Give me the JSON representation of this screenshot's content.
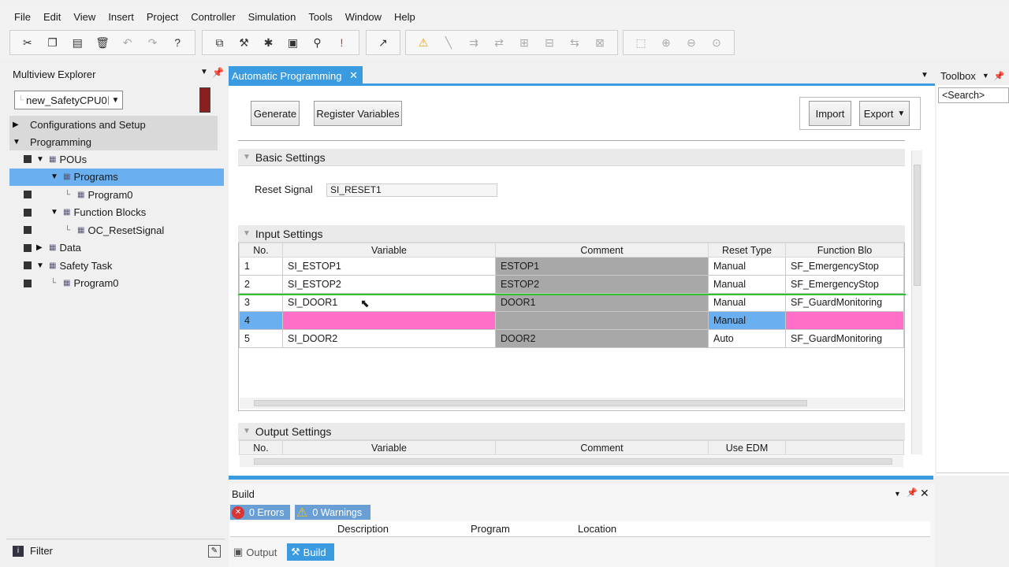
{
  "menu": [
    "File",
    "Edit",
    "View",
    "Insert",
    "Project",
    "Controller",
    "Simulation",
    "Tools",
    "Window",
    "Help"
  ],
  "toolbar_icons": [
    "cut-icon",
    "copy-icon",
    "paste-icon",
    "delete-icon",
    "undo-icon",
    "redo-icon",
    "help-icon",
    "window-icon",
    "build-icon",
    "check-icon",
    "report-icon",
    "find-icon",
    "error-icon",
    "online-icon",
    "warning-icon",
    "pencil-icon",
    "diagram-icon",
    "diagram-icon",
    "diagram-icon",
    "diagram-icon",
    "diagram-icon",
    "diagram-icon",
    "fit-icon",
    "zoom-in-icon",
    "zoom-out-icon",
    "zoom-100-icon"
  ],
  "explorer": {
    "title": "Multiview Explorer",
    "device": "new_SafetyCPU0",
    "config": "Configurations and Setup",
    "programming": "Programming",
    "tree": [
      {
        "label": "POUs",
        "indent": 0,
        "arrow": "▼",
        "icon": "pou-icon"
      },
      {
        "label": "Programs",
        "indent": 1,
        "arrow": "▼",
        "icon": "programs-icon",
        "selected": true
      },
      {
        "label": "Program0",
        "indent": 2,
        "arrow": "",
        "icon": "program-icon"
      },
      {
        "label": "Function Blocks",
        "indent": 1,
        "arrow": "▼",
        "icon": "fb-icon"
      },
      {
        "label": "OC_ResetSignal",
        "indent": 2,
        "arrow": "",
        "icon": "fb-item-icon"
      },
      {
        "label": "Data",
        "indent": 0,
        "arrow": "▶",
        "icon": "data-icon"
      },
      {
        "label": "Safety Task",
        "indent": 0,
        "arrow": "▼",
        "icon": "task-icon"
      },
      {
        "label": "Program0",
        "indent": 1,
        "arrow": "",
        "icon": "program-icon"
      }
    ],
    "filter": "Filter"
  },
  "editor": {
    "tab": "Automatic Programming",
    "generate": "Generate",
    "register": "Register Variables",
    "import": "Import",
    "export": "Export",
    "basic_settings": "Basic Settings",
    "reset_label": "Reset Signal",
    "reset_value": "SI_RESET1",
    "input_settings": "Input Settings",
    "input_headers": [
      "No.",
      "Variable",
      "Comment",
      "Reset Type",
      "Function Blo"
    ],
    "input_rows": [
      {
        "no": "1",
        "variable": "SI_ESTOP1",
        "comment": "ESTOP1",
        "reset": "Manual",
        "fb": "SF_EmergencyStop"
      },
      {
        "no": "2",
        "variable": "SI_ESTOP2",
        "comment": "ESTOP2",
        "reset": "Manual",
        "fb": "SF_EmergencyStop"
      },
      {
        "no": "3",
        "variable": "SI_DOOR1",
        "comment": "DOOR1",
        "reset": "Manual",
        "fb": "SF_GuardMonitoring"
      },
      {
        "no": "4",
        "variable": "",
        "comment": "",
        "reset": "Manual",
        "fb": ""
      },
      {
        "no": "5",
        "variable": "SI_DOOR2",
        "comment": "DOOR2",
        "reset": "Auto",
        "fb": "SF_GuardMonitoring"
      }
    ],
    "output_settings": "Output Settings",
    "output_headers": [
      "No.",
      "Variable",
      "Comment",
      "Use EDM"
    ]
  },
  "toolbox": {
    "title": "Toolbox",
    "search": "<Search>"
  },
  "build": {
    "title": "Build",
    "errors": "0  Errors",
    "warnings": "0  Warnings",
    "headers": [
      "Description",
      "Program",
      "Location"
    ],
    "tab_output": "Output",
    "tab_build": "Build"
  },
  "colors": {
    "selected": "#6ab0f0",
    "highlight_row": "#ff6ec7",
    "comment_cell": "#a8a8a8",
    "accent": "#3a9be0"
  }
}
